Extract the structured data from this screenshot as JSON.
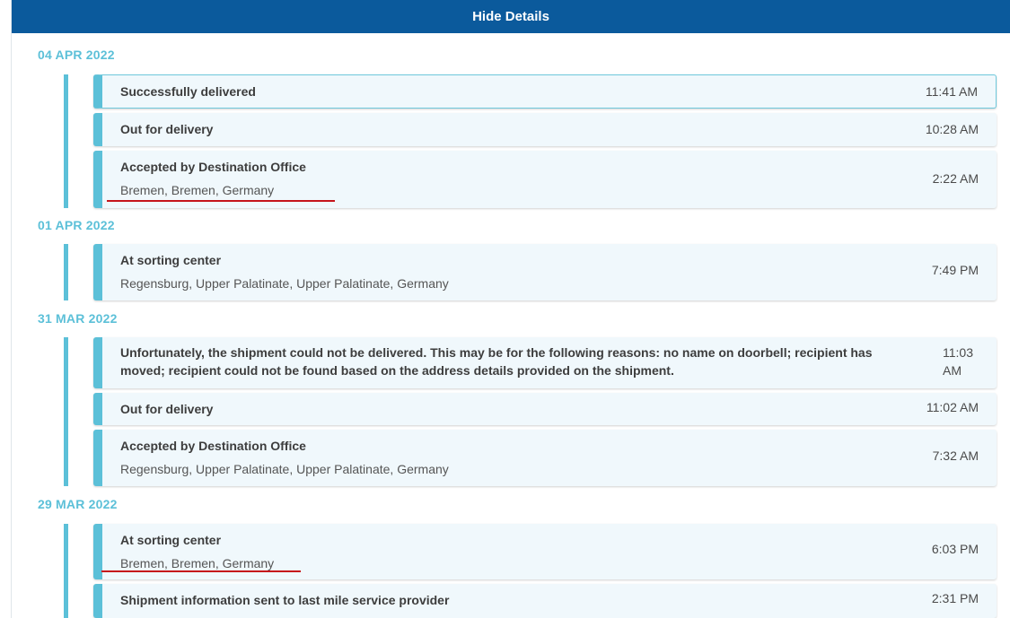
{
  "header": {
    "toggle_label": "Hide Details"
  },
  "groups": [
    {
      "date": "04 APR 2022",
      "events": [
        {
          "title": "Successfully delivered",
          "location": "",
          "time": "11:41 AM"
        },
        {
          "title": "Out for delivery",
          "location": "",
          "time": "10:28 AM"
        },
        {
          "title": "Accepted by Destination Office",
          "location": "Bremen, Bremen, Germany",
          "time": "2:22 AM"
        }
      ]
    },
    {
      "date": "01 APR 2022",
      "events": [
        {
          "title": "At sorting center",
          "location": "Regensburg, Upper Palatinate, Upper Palatinate, Germany",
          "time": "7:49 PM"
        }
      ]
    },
    {
      "date": "31 MAR 2022",
      "events": [
        {
          "title": "Unfortunately, the shipment could not be delivered. This may be for the following reasons: no name on doorbell; recipient has moved; recipient could not be found based on the address details provided on the shipment.",
          "location": "",
          "time": "11:03 AM"
        },
        {
          "title": "Out for delivery",
          "location": "",
          "time": "11:02 AM"
        },
        {
          "title": "Accepted by Destination Office",
          "location": "Regensburg, Upper Palatinate, Upper Palatinate, Germany",
          "time": "7:32 AM"
        }
      ]
    },
    {
      "date": "29 MAR 2022",
      "events": [
        {
          "title": "At sorting center",
          "location": "Bremen, Bremen, Germany",
          "time": "6:03 PM"
        },
        {
          "title": "Shipment information sent to last mile service provider",
          "location": "",
          "time": "2:31 PM"
        }
      ]
    }
  ],
  "colors": {
    "header_bg": "#0b5a9c",
    "accent": "#5cc0d8",
    "annotation": "#c6141b"
  }
}
